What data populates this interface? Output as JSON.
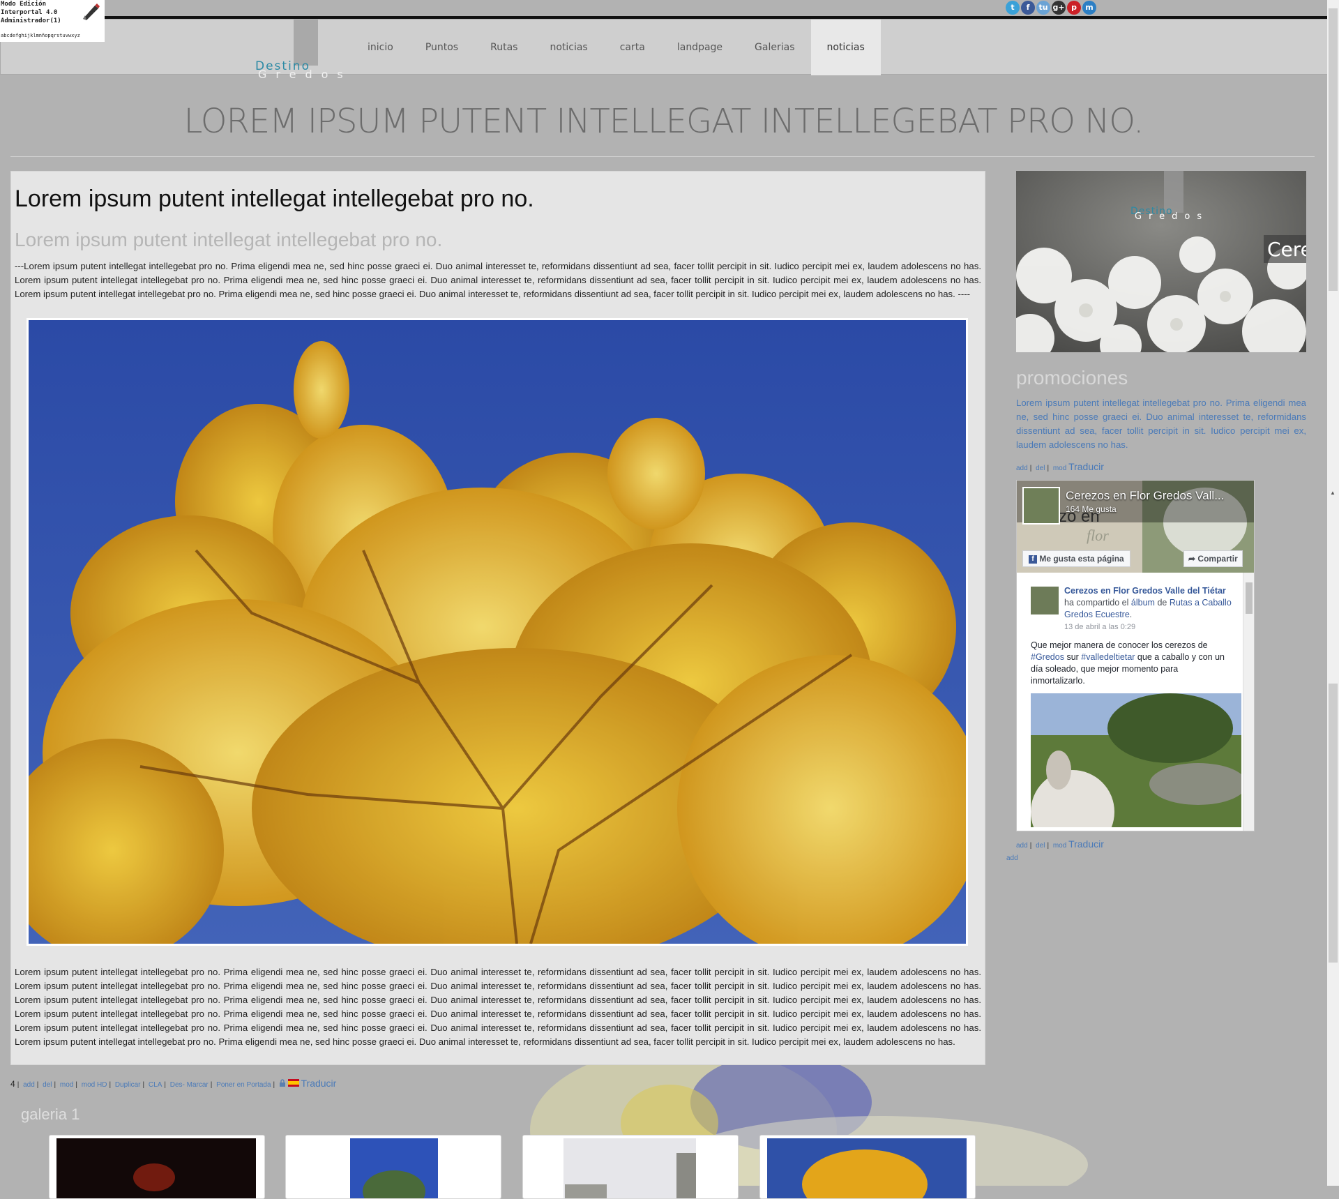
{
  "admin": {
    "line1": "Modo Edición",
    "line2": "Interportal 4.0",
    "line3": "Administrador(1)",
    "alphabet": "abcdefghijklmnñopqrstuvwxyz"
  },
  "logo": {
    "top": "Destino",
    "bottom": "Gredos"
  },
  "nav": [
    "inicio",
    "Puntos",
    "Rutas",
    "noticias",
    "carta",
    "landpage",
    "Galerias",
    "noticias"
  ],
  "social_icons": [
    {
      "name": "twitter-icon",
      "glyph": "t",
      "color": "#3aa1d8"
    },
    {
      "name": "facebook-icon",
      "glyph": "f",
      "color": "#3b5998"
    },
    {
      "name": "tuenti-icon",
      "glyph": "tu",
      "color": "#6aa3d5"
    },
    {
      "name": "google-plus-icon",
      "glyph": "g+",
      "color": "#333333"
    },
    {
      "name": "pinterest-icon",
      "glyph": "p",
      "color": "#cb2027"
    },
    {
      "name": "meneame-icon",
      "glyph": "m",
      "color": "#2d7fc4"
    }
  ],
  "page_title": "LOREM IPSUM PUTENT INTELLEGAT INTELLEGEBAT PRO NO.",
  "article": {
    "heading": "Lorem ipsum putent intellegat intellegebat pro no.",
    "subheading": "Lorem ipsum putent intellegat intellegebat pro no.",
    "intro": "---Lorem ipsum putent intellegat intellegebat pro no. Prima eligendi mea ne, sed hinc posse graeci ei. Duo animal interesset te, reformidans dissentiunt ad sea, facer tollit percipit in sit. Iudico percipit mei ex, laudem adolescens no has. Lorem ipsum putent intellegat intellegebat pro no. Prima eligendi mea ne, sed hinc posse graeci ei. Duo animal interesset te, reformidans dissentiunt ad sea, facer tollit percipit in sit. Iudico percipit mei ex, laudem adolescens no has. Lorem ipsum putent intellegat intellegebat pro no. Prima eligendi mea ne, sed hinc posse graeci ei. Duo animal interesset te, reformidans dissentiunt ad sea, facer tollit percipit in sit. Iudico percipit mei ex, laudem adolescens no has. ----",
    "body": "Lorem ipsum putent intellegat intellegebat pro no. Prima eligendi mea ne, sed hinc posse graeci ei. Duo animal interesset te, reformidans dissentiunt ad sea, facer tollit percipit in sit. Iudico percipit mei ex, laudem adolescens no has. Lorem ipsum putent intellegat intellegebat pro no. Prima eligendi mea ne, sed hinc posse graeci ei. Duo animal interesset te, reformidans dissentiunt ad sea, facer tollit percipit in sit. Iudico percipit mei ex, laudem adolescens no has. Lorem ipsum putent intellegat intellegebat pro no. Prima eligendi mea ne, sed hinc posse graeci ei. Duo animal interesset te, reformidans dissentiunt ad sea, facer tollit percipit in sit. Iudico percipit mei ex, laudem adolescens no has. Lorem ipsum putent intellegat intellegebat pro no. Prima eligendi mea ne, sed hinc posse graeci ei. Duo animal interesset te, reformidans dissentiunt ad sea, facer tollit percipit in sit. Iudico percipit mei ex, laudem adolescens no has. Lorem ipsum putent intellegat intellegebat pro no. Prima eligendi mea ne, sed hinc posse graeci ei. Duo animal interesset te, reformidans dissentiunt ad sea, facer tollit percipit in sit. Iudico percipit mei ex, laudem adolescens no has. Lorem ipsum putent intellegat intellegebat pro no. Prima eligendi mea ne, sed hinc posse graeci ei. Duo animal interesset te, reformidans dissentiunt ad sea, facer tollit percipit in sit. Iudico percipit mei ex, laudem adolescens no has."
  },
  "article_admin": {
    "count": "4",
    "actions": [
      "add",
      "del",
      "mod",
      "mod HD",
      "Duplicar",
      "CLA",
      "Des- Marcar",
      "Poner en Portada"
    ],
    "translate": "Traducir"
  },
  "sidebar": {
    "banner_logo_top": "Destino",
    "banner_logo_bottom": "Gredos",
    "banner_caption": "Cere",
    "promo_title": "promociones",
    "promo_text": "Lorem ipsum putent intellegat intellegebat pro no. Prima eligendi mea ne, sed hinc posse graeci ei. Duo animal interesset te, reformidans dissentiunt ad sea, facer tollit percipit in sit. Iudico percipit mei ex, laudem adolescens no has.",
    "promo_admin": [
      "add",
      "del",
      "mod"
    ],
    "translate": "Traducir",
    "fb_admin": [
      "add",
      "del",
      "mod"
    ],
    "extra_add": "add"
  },
  "facebook": {
    "page_name": "Cerezos en Flor Gredos Vall...",
    "likes": "164 Me gusta",
    "cover_text_1": "zo en",
    "cover_text_2": "flor",
    "like_button": "Me gusta esta página",
    "share_button": "Compartir",
    "post_author": "Cerezos en Flor Gredos Valle del Tiétar",
    "post_shared": "ha compartido el",
    "post_album": "álbum",
    "post_of": "de",
    "post_target": "Rutas a Caballo Gredos Ecuestre",
    "post_date": "13 de abril a las 0:29",
    "post_text_1": "Que mejor manera de conocer los cerezos de",
    "post_tag_1": "#Gredos",
    "post_text_2": "sur",
    "post_tag_2": "#valledeltietar",
    "post_text_3": "que a caballo y con un día soleado, que mejor momento para inmortalizarlo."
  },
  "gallery": {
    "title": "galeria 1"
  },
  "colors": {
    "background": "#b2b2b2",
    "header": "#cfcfcf",
    "link": "#4a7ab8",
    "logo_accent": "#2c8aa5",
    "sky": "#2f51a8",
    "foliage": "#e3a51a"
  }
}
